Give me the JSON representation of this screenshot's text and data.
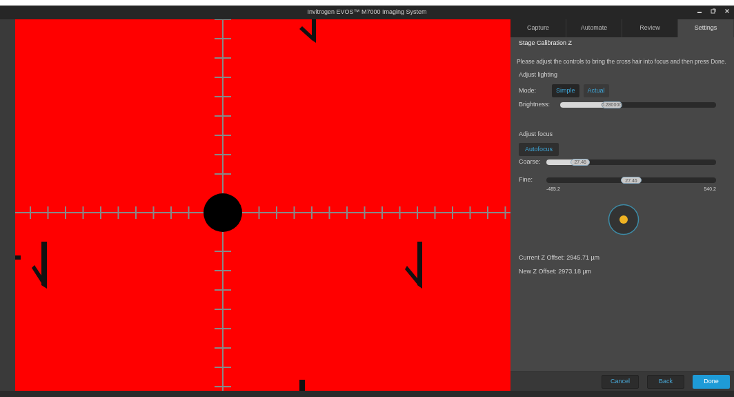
{
  "window": {
    "title": "Invitrogen EVOS™ M7000 Imaging System"
  },
  "tabs": [
    {
      "label": "Capture",
      "selected": false
    },
    {
      "label": "Automate",
      "selected": false
    },
    {
      "label": "Review",
      "selected": false
    },
    {
      "label": "Settings",
      "selected": true
    }
  ],
  "panel": {
    "title": "Stage Calibration Z",
    "instruction": "Please adjust the controls to bring the cross hair into focus and then press Done.",
    "lighting": {
      "heading": "Adjust lighting",
      "mode_label": "Mode:",
      "modes": [
        {
          "label": "Simple",
          "selected": true
        },
        {
          "label": "Actual",
          "selected": false
        }
      ],
      "brightness": {
        "label": "Brightness:",
        "level": 0.33,
        "reading": "0.280000"
      }
    },
    "focus": {
      "heading": "Adjust focus",
      "autofocus": "Autofocus",
      "coarse": {
        "label": "Coarse:",
        "level": 0.2,
        "reading": "27.46"
      },
      "fine": {
        "label": "Fine:",
        "level": 0.5,
        "reading": "27.46",
        "min": "-485.2",
        "max": "540.2"
      }
    },
    "current_offset": "Current Z Offset:  2945.71 µm",
    "new_offset": "New Z Offset:  2973.18 µm"
  },
  "footer": {
    "buttons": [
      {
        "label": "Cancel",
        "primary": false
      },
      {
        "label": "Back",
        "primary": false
      },
      {
        "label": "Done",
        "primary": true
      }
    ]
  }
}
